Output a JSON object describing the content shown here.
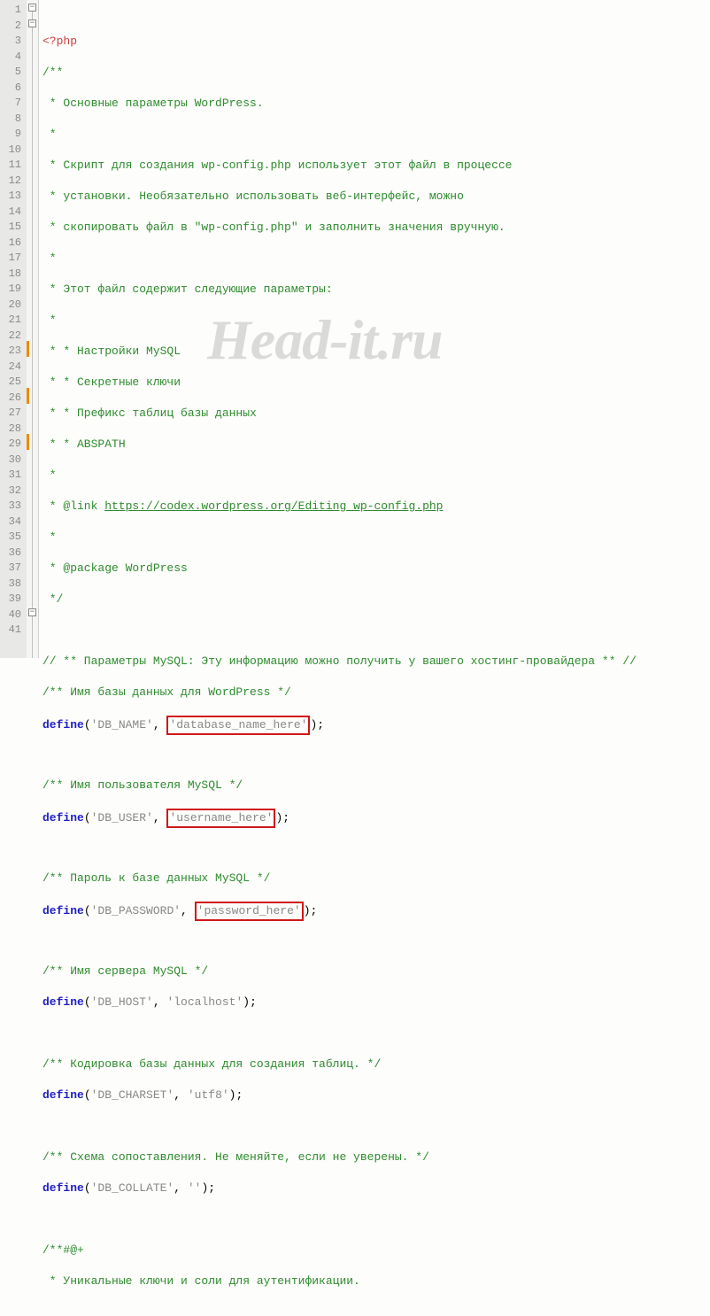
{
  "watermark": "Head-it.ru",
  "code": {
    "l1_tag": "<?php",
    "l2": "/**",
    "l3": " * Основные параметры WordPress.",
    "l4": " *",
    "l5": " * Скрипт для создания wp-config.php использует этот файл в процессе",
    "l6": " * установки. Необязательно использовать веб-интерфейс, можно",
    "l7": " * скопировать файл в \"wp-config.php\" и заполнить значения вручную.",
    "l8": " *",
    "l9": " * Этот файл содержит следующие параметры:",
    "l10": " *",
    "l11": " * * Настройки MySQL",
    "l12": " * * Секретные ключи",
    "l13": " * * Префикс таблиц базы данных",
    "l14": " * * ABSPATH",
    "l15": " *",
    "l16a": " * @link ",
    "l16b": "https://codex.wordpress.org/Editing_wp-config.php",
    "l17": " *",
    "l18": " * @package WordPress",
    "l19": " */",
    "l21": "// ** Параметры MySQL: Эту информацию можно получить у вашего хостинг-провайдера ** //",
    "l22": "/** Имя базы данных для WordPress */",
    "l23_def": "define",
    "l23_a": "'DB_NAME'",
    "l23_b": "'database_name_here'",
    "l25": "/** Имя пользователя MySQL */",
    "l26_a": "'DB_USER'",
    "l26_b": "'username_here'",
    "l28": "/** Пароль к базе данных MySQL */",
    "l29_a": "'DB_PASSWORD'",
    "l29_b": "'password_here'",
    "l31": "/** Имя сервера MySQL */",
    "l32_a": "'DB_HOST'",
    "l32_b": "'localhost'",
    "l34": "/** Кодировка базы данных для создания таблиц. */",
    "l35_a": "'DB_CHARSET'",
    "l35_b": "'utf8'",
    "l37": "/** Схема сопоставления. Не меняйте, если не уверены. */",
    "l38_a": "'DB_COLLATE'",
    "l38_b": "''",
    "l40": "/**#@+",
    "l41": " * Уникальные ключи и соли для аутентификации.",
    "paren_open": "(",
    "paren_close": ");",
    "comma": ", "
  },
  "lines": [
    "1",
    "2",
    "3",
    "4",
    "5",
    "6",
    "7",
    "8",
    "9",
    "10",
    "11",
    "12",
    "13",
    "14",
    "15",
    "16",
    "17",
    "18",
    "19",
    "20",
    "21",
    "22",
    "23",
    "24",
    "25",
    "26",
    "27",
    "28",
    "29",
    "30",
    "31",
    "32",
    "33",
    "34",
    "35",
    "36",
    "37",
    "38",
    "39",
    "40",
    "41"
  ]
}
